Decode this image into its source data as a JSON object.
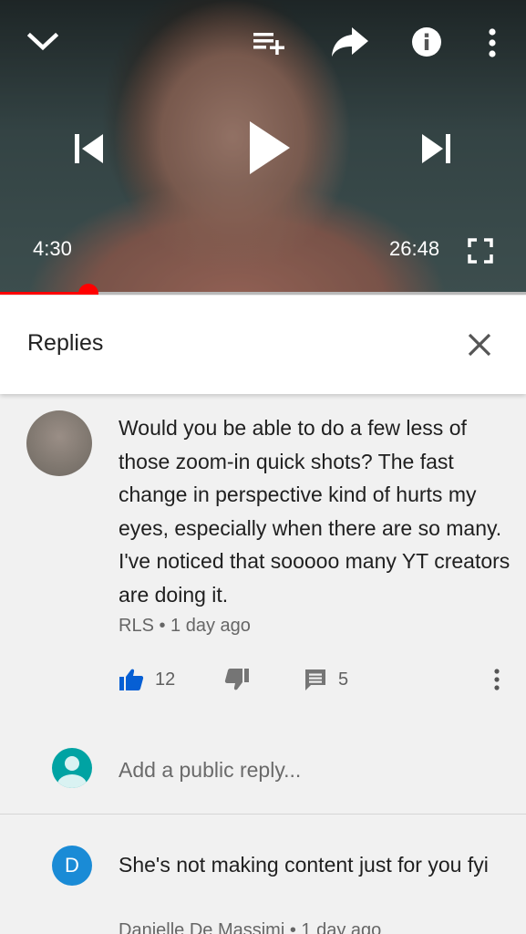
{
  "player": {
    "current_time": "4:30",
    "duration": "26:48",
    "progress_fraction": 0.168,
    "controls": {
      "minimize_icon": "chevron-down-icon",
      "add_to_playlist_icon": "playlist-add-icon",
      "share_icon": "share-icon",
      "info_icon": "info-icon",
      "more_icon": "more-vert-icon",
      "previous_icon": "skip-previous-icon",
      "play_icon": "play-icon",
      "next_icon": "skip-next-icon",
      "fullscreen_icon": "fullscreen-icon"
    },
    "accent_color": "#ff0000"
  },
  "replies_panel": {
    "title": "Replies",
    "close_icon": "close-icon"
  },
  "comment": {
    "text": "Would you be able to do a few less of those zoom-in quick shots? The fast change in perspective kind of hurts my eyes, especially when there are so many. I've noticed that sooooo many YT creators are doing it.",
    "author": "RLS",
    "separator": "•",
    "age": "1 day ago",
    "likes": "12",
    "replies": "5",
    "like_color": "#065fd4"
  },
  "reply_box": {
    "placeholder": "Add a public reply..."
  },
  "reply": {
    "avatar_letter": "D",
    "avatar_color": "#1a8bd6",
    "text": "She's not making content just for you fyi",
    "author": "Danielle De Massimi",
    "separator": "•",
    "age": "1 day ago"
  }
}
